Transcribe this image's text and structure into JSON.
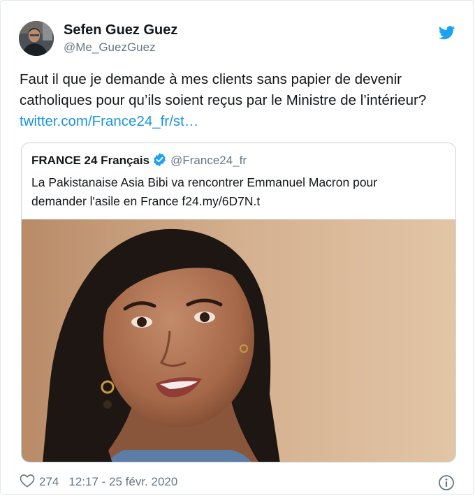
{
  "tweet": {
    "author": {
      "name": "Sefen Guez Guez",
      "handle": "@Me_GuezGuez"
    },
    "text_lines": [
      "Faut il que je demande à mes clients sans papier de devenir",
      "catholiques pour qu’ils soient reçus par le Ministre de l’intérieur?"
    ],
    "link": "twitter.com/France24_fr/st…",
    "quoted": {
      "name": "FRANCE 24 Français",
      "handle": "@France24_fr",
      "verified": true,
      "text_lines": [
        "La Pakistanaise Asia Bibi va rencontrer Emmanuel Macron pour",
        "demander l'asile en France f24.my/6D7N.t"
      ]
    },
    "likes": "274",
    "timestamp": "12:17 - 25 févr. 2020"
  },
  "colors": {
    "link": "#1b95e0",
    "secondary_text": "#657786",
    "border": "#e1e8ed",
    "twitter_blue": "#1da1f2"
  },
  "icons": {
    "brand": "twitter-bird-icon",
    "verified": "verified-badge-icon",
    "like": "heart-icon",
    "info": "info-icon"
  }
}
